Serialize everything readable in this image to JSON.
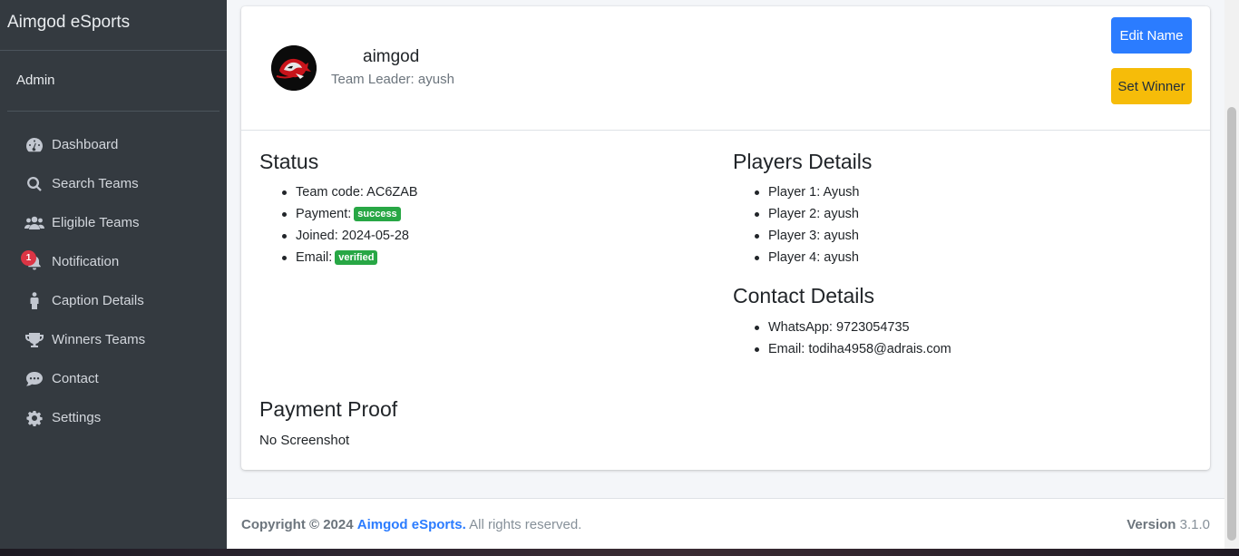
{
  "brand": "Aimgod eSports",
  "user": "Admin",
  "nav": [
    {
      "label": "Dashboard",
      "icon": "dashboard-icon"
    },
    {
      "label": "Search Teams",
      "icon": "search-icon"
    },
    {
      "label": "Eligible Teams",
      "icon": "users-icon"
    },
    {
      "label": "Notification",
      "icon": "bell-icon",
      "badge": "1"
    },
    {
      "label": "Caption Details",
      "icon": "person-icon"
    },
    {
      "label": "Winners Teams",
      "icon": "trophy-icon"
    },
    {
      "label": "Contact",
      "icon": "comment-icon"
    },
    {
      "label": "Settings",
      "icon": "gear-icon"
    }
  ],
  "team": {
    "name": "aimgod",
    "leader": "Team Leader: ayush",
    "edit_label": "Edit Name",
    "winner_label": "Set Winner"
  },
  "status": {
    "title": "Status",
    "code": "Team code: AC6ZAB",
    "payment_label": "Payment:",
    "payment_badge": "success",
    "joined": "Joined: 2024-05-28",
    "email_label": "Email:",
    "email_badge": "verified"
  },
  "players": {
    "title": "Players Details",
    "list": [
      "Player 1: Ayush",
      "Player 2: ayush",
      "Player 3: ayush",
      "Player 4: ayush"
    ]
  },
  "contact": {
    "title": "Contact Details",
    "whatsapp": "WhatsApp: 9723054735",
    "email": "Email: todiha4958@adrais.com"
  },
  "payment_proof": {
    "title": "Payment Proof",
    "text": "No Screenshot"
  },
  "footer": {
    "copyright": "Copyright © 2024",
    "brand_link": "Aimgod eSports.",
    "rights": "All rights reserved.",
    "version_label": "Version",
    "version": "3.1.0"
  },
  "colors": {
    "sidebar_bg": "#343a40",
    "primary": "#2b7cff",
    "warning": "#f6bc09",
    "success": "#28a745",
    "danger": "#dc3545"
  }
}
